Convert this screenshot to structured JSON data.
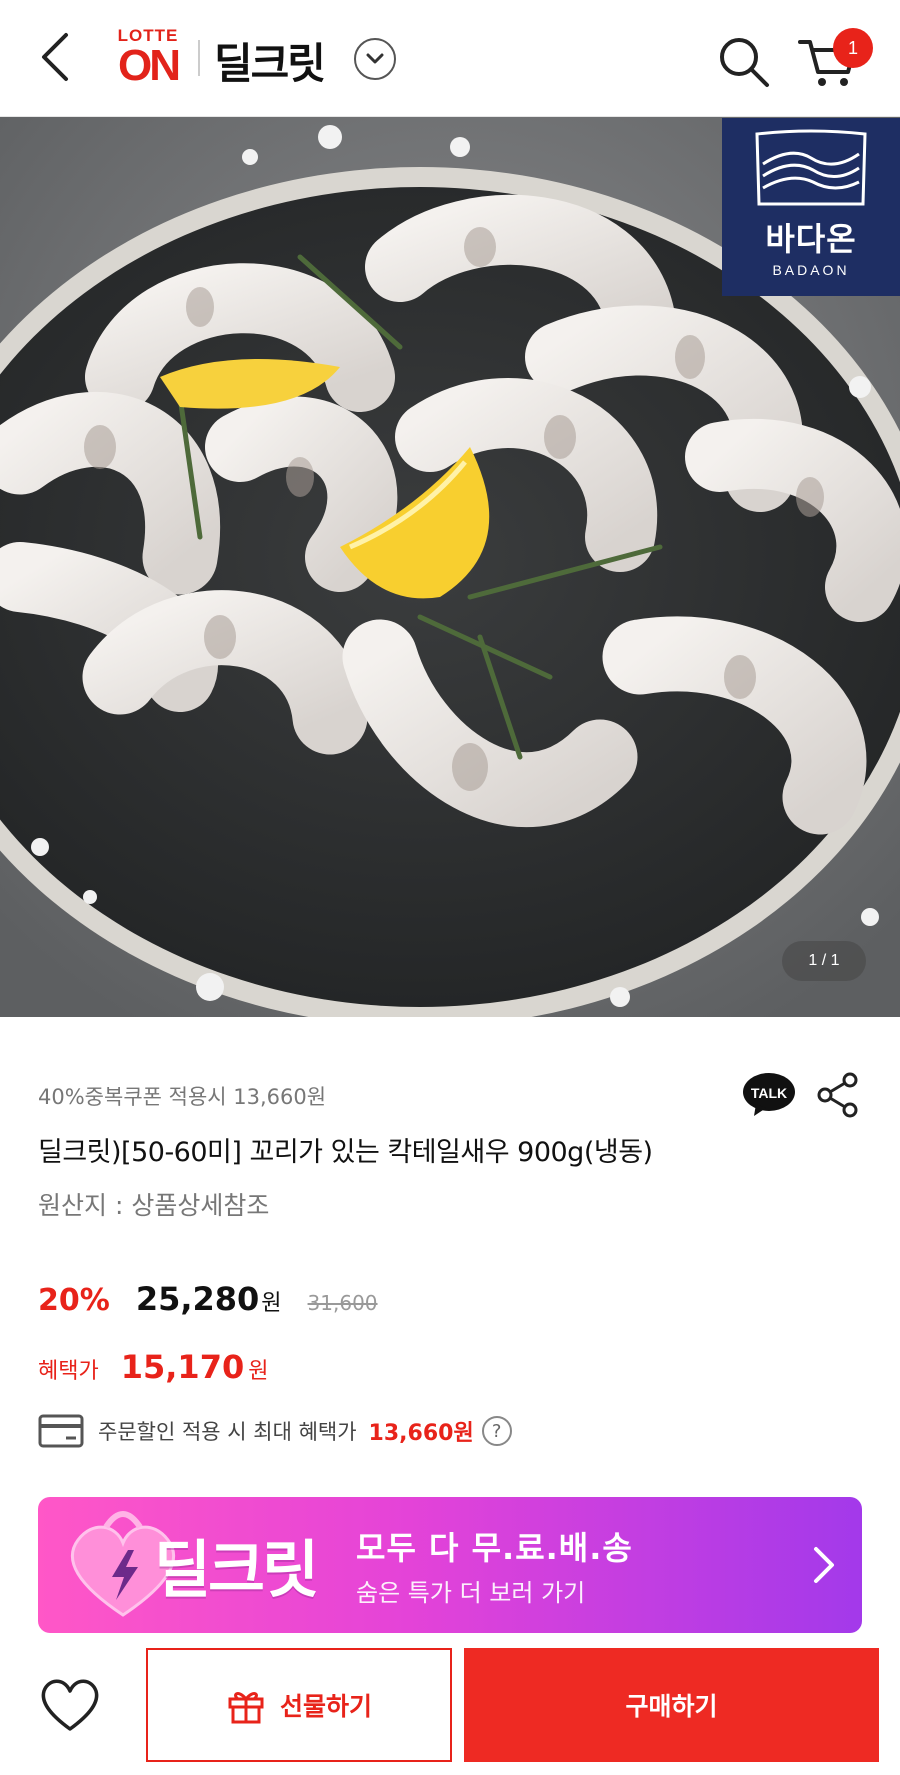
{
  "header": {
    "logo_top": "LOTTE",
    "logo_main": "ON",
    "brand_title": "딜크릿",
    "cart_count": "1"
  },
  "hero": {
    "seller_name_kr": "바다온",
    "seller_name_en": "BADAON",
    "image_counter": "1 / 1"
  },
  "product": {
    "coupon_note": "40%중복쿠폰 적용시 13,660원",
    "title": "딜크릿)[50-60미] 꼬리가 있는 칵테일새우 900g(냉동)",
    "origin": "원산지 : 상품상세참조",
    "discount_rate": "20%",
    "price": "25,280",
    "price_unit": "원",
    "original_price": "31,600",
    "benefit_label": "혜택가",
    "benefit_price": "15,170",
    "benefit_unit": "원",
    "max_benefit_text": "주문할인 적용 시 최대 혜택가",
    "max_benefit_amount": "13,660원",
    "help_symbol": "?",
    "talk_label": "TALK"
  },
  "promo": {
    "brand": "딜크릿",
    "title": "모두 다 무.료.배.송",
    "subtitle": "숨은 특가 더 보러 가기"
  },
  "bottom_bar": {
    "gift_label": "선물하기",
    "buy_label": "구매하기"
  },
  "colors": {
    "accent": "#e8231a",
    "seller_badge": "#1e2e63",
    "promo_start": "#ff57c7",
    "promo_end": "#a339ea"
  }
}
